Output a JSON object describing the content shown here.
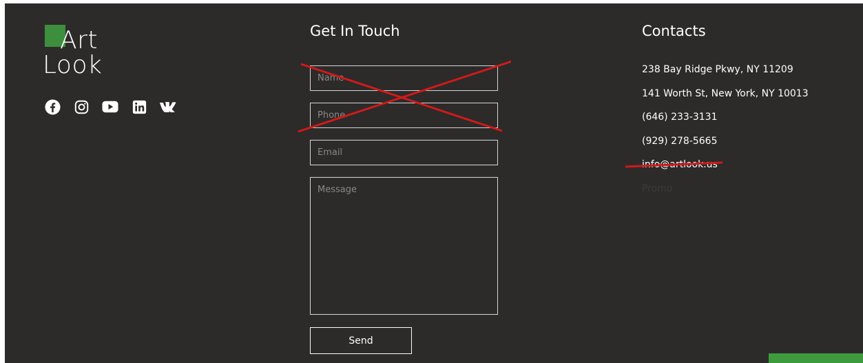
{
  "logo": {
    "line1": "Art",
    "line2": "Look",
    "accent_color": "#3d8f3d"
  },
  "socials": [
    {
      "name": "facebook-icon"
    },
    {
      "name": "instagram-icon"
    },
    {
      "name": "youtube-icon"
    },
    {
      "name": "linkedin-icon"
    },
    {
      "name": "vk-icon"
    }
  ],
  "contact_form": {
    "title": "Get In Touch",
    "name_placeholder": "Name",
    "phone_placeholder": "Phone",
    "email_placeholder": "Email",
    "message_placeholder": "Message",
    "send_label": "Send"
  },
  "contacts": {
    "title": "Contacts",
    "address1": "238 Bay Ridge Pkwy, NY 11209",
    "address2": "141 Worth St, New York, NY 10013",
    "phone1": "(646) 233-3131",
    "phone2": "(929) 278-5665",
    "email": "info@artlook.us",
    "promo": "Promo"
  },
  "colors": {
    "background": "#2d2a2a",
    "annotation_red": "#d11a1a",
    "green_tab": "#3d9a3d"
  }
}
